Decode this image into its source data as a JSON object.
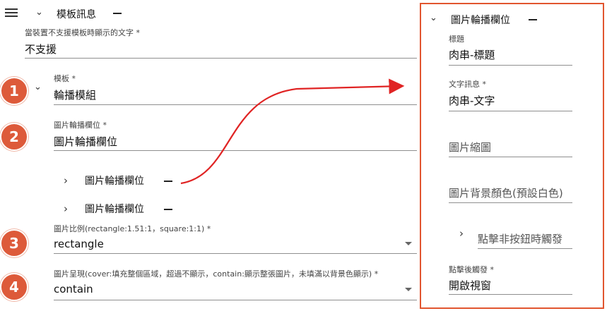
{
  "left": {
    "section_title": "模板訊息",
    "alt_text": {
      "label": "當裝置不支援模板時顯示的文字 *",
      "value": "不支援"
    },
    "template": {
      "label": "模板 *",
      "value": "輪播模組"
    },
    "carousel_column": {
      "label": "圖片輪播欄位 *",
      "value": "圖片輪播欄位"
    },
    "columns": [
      {
        "label": "圖片輪播欄位"
      },
      {
        "label": "圖片輪播欄位"
      }
    ],
    "image_ratio": {
      "label": "圖片比例(rectangle:1.51:1，square:1:1) *",
      "value": "rectangle"
    },
    "image_size": {
      "label": "圖片呈現(cover:填充整個區域，超過不顯示，contain:顯示整張圖片，未填滿以背景色顯示) *",
      "value": "contain"
    },
    "badges": [
      "1",
      "2",
      "3",
      "4"
    ]
  },
  "panel": {
    "title": "圖片輪播欄位",
    "fields": {
      "title": {
        "label": "標題",
        "value": "肉串-標題"
      },
      "text": {
        "label": "文字訊息 *",
        "value": "肉串-文字"
      },
      "thumbnail": {
        "placeholder": "圖片縮圖"
      },
      "bg_color": {
        "placeholder": "圖片背景顏色(預設白色)"
      },
      "non_button": {
        "label": "點擊非按鈕時觸發"
      },
      "click_action": {
        "label": "點擊後觸發 *",
        "value": "開啟視窗"
      }
    }
  },
  "colors": {
    "badge": "#dd5a3a",
    "panel_border": "#e1552f",
    "arrow": "#e02424"
  },
  "icons": [
    "menu-icon",
    "chevron-down-icon",
    "chevron-right-icon",
    "minus-icon",
    "dropdown-arrow-icon"
  ]
}
